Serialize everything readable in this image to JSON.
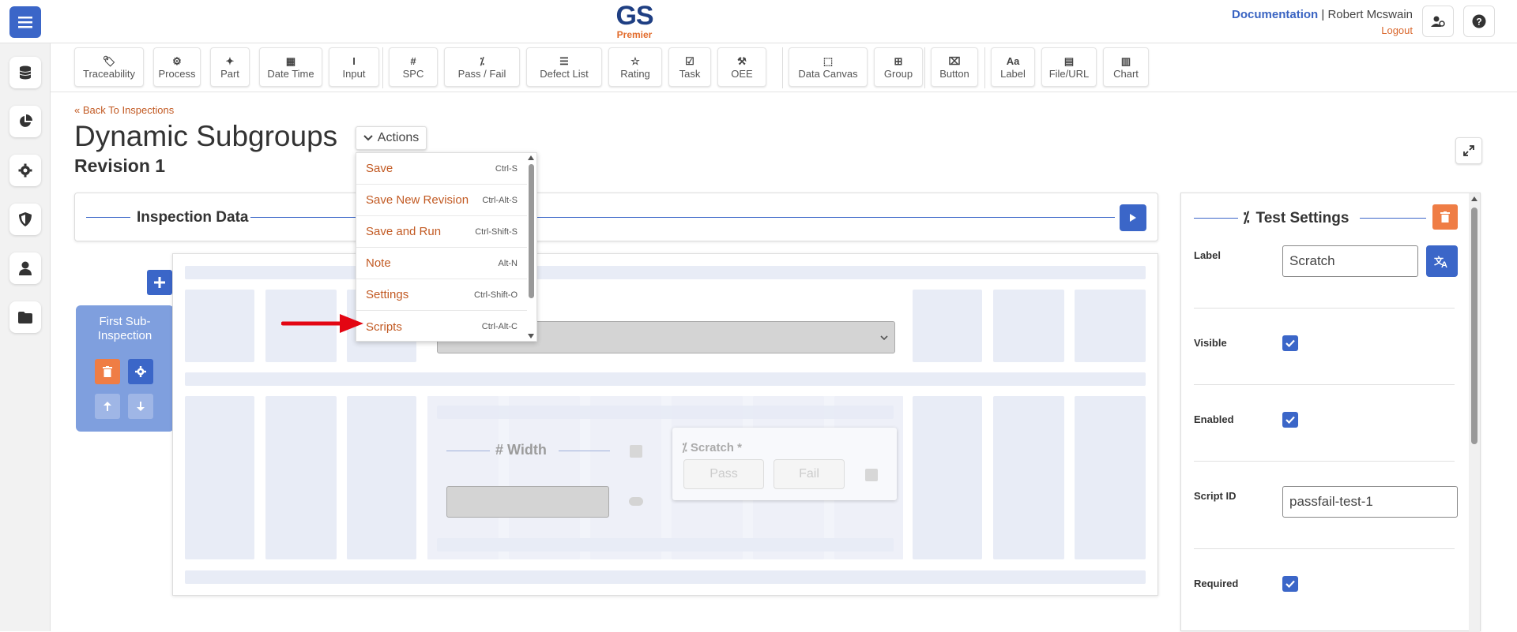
{
  "header": {
    "logo_text": "GS",
    "logo_sub": "Premier",
    "documentation": "Documentation",
    "separator": "|",
    "user": "Robert Mcswain",
    "logout": "Logout"
  },
  "toolbar": {
    "items": [
      "Traceability",
      "Process",
      "Part",
      "Date Time",
      "Input",
      "SPC",
      "Pass / Fail",
      "Defect List",
      "Rating",
      "Task",
      "OEE",
      "Data Canvas",
      "Group",
      "Button",
      "Label",
      "File/URL",
      "Chart"
    ],
    "icons": [
      "tag-icon",
      "process-icon",
      "puzzle-icon",
      "calendar-icon",
      "cursor-icon",
      "hash-icon",
      "pass-fail-icon",
      "list-icon",
      "star-icon",
      "task-icon",
      "oee-icon",
      "canvas-icon",
      "grid-icon",
      "button-icon",
      "label-icon",
      "file-icon",
      "chart-icon"
    ],
    "symbols": [
      "🏷",
      "⚙",
      "✦",
      "▦",
      "I",
      "#",
      "⁒",
      "☰",
      "☆",
      "☑",
      "⚒",
      "⬚",
      "⊞",
      "⌧",
      "Aa",
      "▤",
      "▥"
    ]
  },
  "page": {
    "back_link": "Back To Inspections",
    "title": "Dynamic Subgroups",
    "revision": "Revision 1",
    "actions_label": "Actions"
  },
  "actions_menu": [
    {
      "label": "Save",
      "shortcut": "Ctrl-S"
    },
    {
      "label": "Save New Revision",
      "shortcut": "Ctrl-Alt-S"
    },
    {
      "label": "Save and Run",
      "shortcut": "Ctrl-Shift-S"
    },
    {
      "label": "Note",
      "shortcut": "Alt-N"
    },
    {
      "label": "Settings",
      "shortcut": "Ctrl-Shift-O"
    },
    {
      "label": "Scripts",
      "shortcut": "Ctrl-Alt-C"
    }
  ],
  "inspection": {
    "title": "Inspection Data",
    "sub_inspection_label": "First Sub-Inspection",
    "width_label": "# Width",
    "scratch_label": "Scratch *",
    "pass_label": "Pass",
    "fail_label": "Fail"
  },
  "test_settings": {
    "title": "Test Settings",
    "label_field": "Label",
    "label_value": "Scratch",
    "visible_label": "Visible",
    "enabled_label": "Enabled",
    "script_id_label": "Script ID",
    "script_id_value": "passfail-test-1",
    "required_label": "Required"
  },
  "colors": {
    "primary": "#3b66c8",
    "accent": "#c25a23",
    "danger": "#ef7d45"
  }
}
